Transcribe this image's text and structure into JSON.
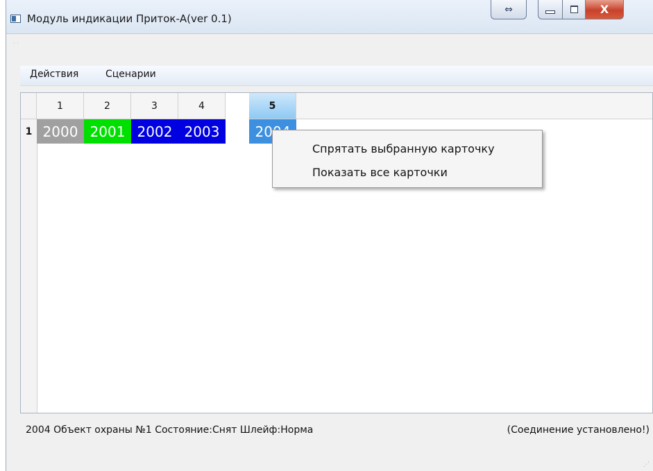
{
  "window": {
    "title": "Модуль индикации Приток-А(ver 0.1)",
    "controls": {
      "swap": "⇔",
      "close": "X"
    }
  },
  "menu": [
    {
      "label": "Действия"
    },
    {
      "label": "Сценарии"
    }
  ],
  "grid": {
    "columns": [
      "1",
      "2",
      "3",
      "4",
      "5"
    ],
    "selected_column": "5",
    "rows": [
      {
        "header": "1",
        "cells": [
          {
            "value": "2000",
            "color": "#a0a0a0"
          },
          {
            "value": "2001",
            "color": "#00e000"
          },
          {
            "value": "2002",
            "color": "#0000e0"
          },
          {
            "value": "2003",
            "color": "#0000e0"
          },
          {
            "value": "2004",
            "color": "#3d8fe0"
          }
        ]
      }
    ]
  },
  "context_menu": {
    "items": [
      {
        "label": "Спрятать выбранную карточку"
      },
      {
        "label": "Показать все карточки"
      }
    ]
  },
  "status": {
    "left": "2004 Объект охраны №1 Состояние:Снят Шлейф:Норма",
    "right": "(Соединение установлено!)"
  }
}
